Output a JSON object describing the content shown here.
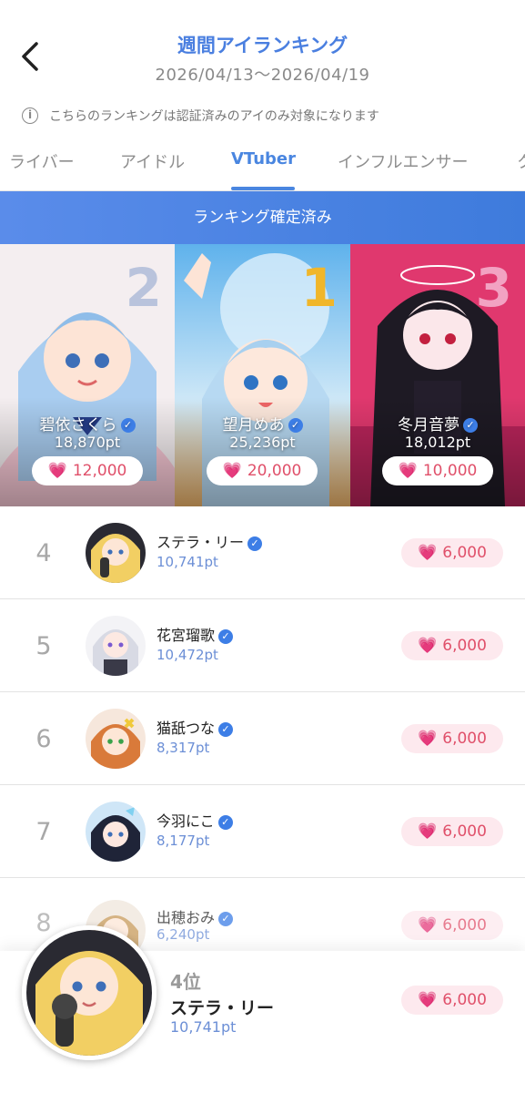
{
  "header": {
    "title": "週間アイランキング",
    "date_range": "2026/04/13〜2026/04/19"
  },
  "notice": {
    "text": "こちらのランキングは認証済みのアイのみ対象になります",
    "icon": "info-icon"
  },
  "tabs": [
    {
      "label": "ライバー",
      "active": false
    },
    {
      "label": "アイドル",
      "active": false
    },
    {
      "label": "VTuber",
      "active": true
    },
    {
      "label": "インフルエンサー",
      "active": false
    },
    {
      "label": "ク",
      "active": false
    }
  ],
  "banner": {
    "text": "ランキング確定済み"
  },
  "podium": [
    {
      "rank": "2",
      "name": "碧依さくら",
      "points": "18,870pt",
      "reward": "12,000",
      "verified": true
    },
    {
      "rank": "1",
      "name": "望月めあ",
      "points": "25,236pt",
      "reward": "20,000",
      "verified": true
    },
    {
      "rank": "3",
      "name": "冬月音夢",
      "points": "18,012pt",
      "reward": "10,000",
      "verified": true
    }
  ],
  "list": [
    {
      "rank": "4",
      "name": "ステラ・リー",
      "points": "10,741pt",
      "reward": "6,000",
      "verified": true
    },
    {
      "rank": "5",
      "name": "花宮瑠歌",
      "points": "10,472pt",
      "reward": "6,000",
      "verified": true
    },
    {
      "rank": "6",
      "name": "猫舐つな",
      "points": "8,317pt",
      "reward": "6,000",
      "verified": true
    },
    {
      "rank": "7",
      "name": "今羽にこ",
      "points": "8,177pt",
      "reward": "6,000",
      "verified": true
    },
    {
      "rank": "8",
      "name": "出穂おみ",
      "points": "6,240pt",
      "reward": "6,000",
      "verified": true
    }
  ],
  "my_rank": {
    "rank_label": "4位",
    "name": "ステラ・リー",
    "points": "10,741pt",
    "reward": "6,000"
  },
  "colors": {
    "accent": "#4a86e0",
    "reward_text": "#e0506a",
    "reward_bg": "#fde9ee",
    "points_text": "#6c8fd6"
  }
}
